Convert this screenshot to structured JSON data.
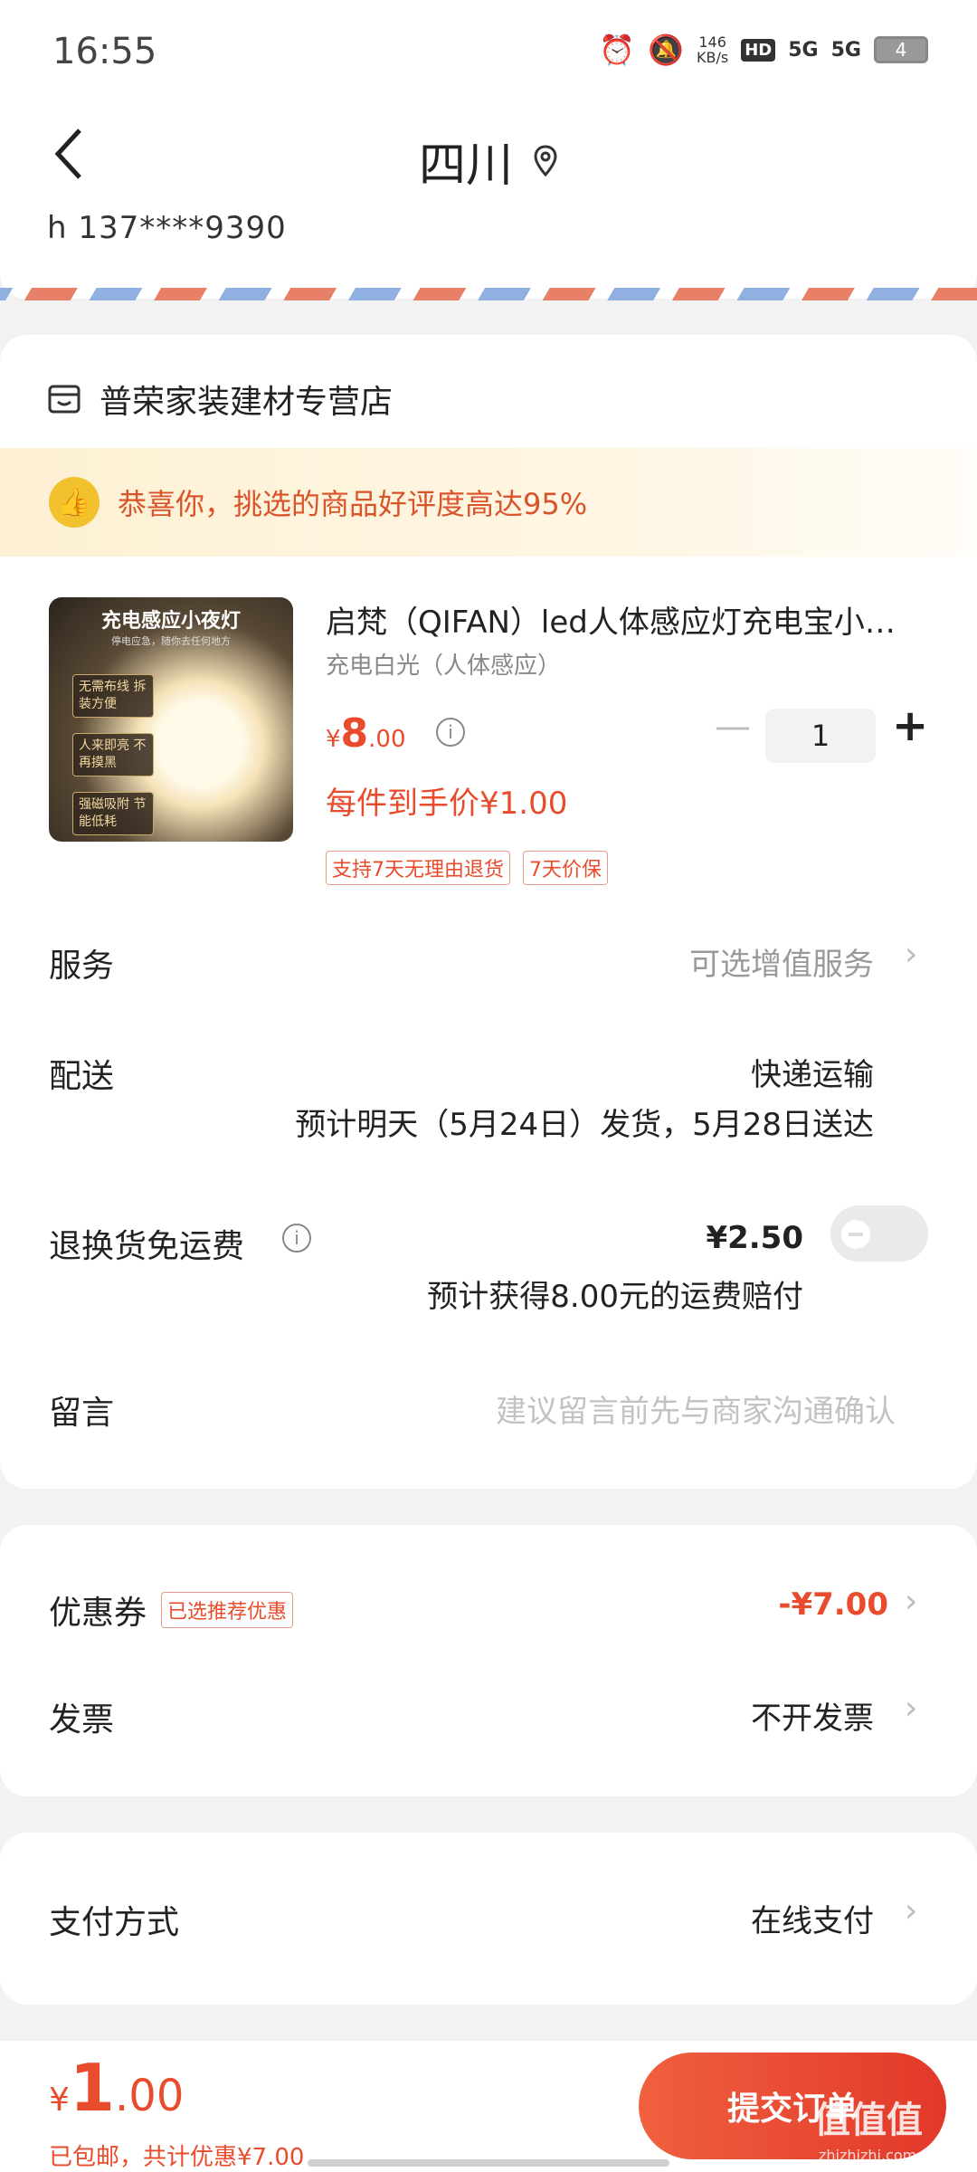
{
  "status_bar": {
    "time": "16:55",
    "net_speed_value": "146",
    "net_speed_unit": "KB/s",
    "hd": "HD",
    "signal1": "5G",
    "signal2": "5G",
    "battery": "4"
  },
  "header": {
    "title": "四川",
    "phone": "h  137****9390"
  },
  "store": {
    "name": "普荣家装建材专营店"
  },
  "banner": {
    "text": "恭喜你，挑选的商品好评度高达95%"
  },
  "product": {
    "image_title": "充电感应小夜灯",
    "image_subtitle": "停电应急，随你去任何地方",
    "image_tags": [
      "无需布线 拆装方便",
      "人来即亮 不再摸黑",
      "强磁吸附 节能低耗"
    ],
    "title": "启梵（QIFAN）led人体感应灯充电宝小夜灯",
    "spec": "充电白光（人体感应）",
    "price_symbol": "¥",
    "price_int": "8",
    "price_dec": ".00",
    "quantity": "1",
    "final_price": "每件到手价¥1.00",
    "badges": [
      "支持7天无理由退货",
      "7天价保"
    ]
  },
  "rows": {
    "service_label": "服务",
    "service_value": "可选增值服务",
    "delivery_label": "配送",
    "delivery_method": "快递运输",
    "delivery_eta": "预计明天（5月24日）发货，5月28日送达",
    "return_label": "退换货免运费",
    "return_price": "¥2.50",
    "return_note": "预计获得8.00元的运费赔付",
    "message_label": "留言",
    "message_placeholder": "建议留言前先与商家沟通确认"
  },
  "coupon": {
    "label": "优惠券",
    "badge": "已选推荐优惠",
    "value": "-¥7.00"
  },
  "invoice": {
    "label": "发票",
    "value": "不开发票"
  },
  "payment": {
    "label": "支付方式",
    "value": "在线支付"
  },
  "bottom": {
    "symbol": "¥",
    "total_int": "1",
    "total_dec": ".00",
    "note": "已包邮，共计优惠¥7.00",
    "submit": "提交订单",
    "watermark": "值值值",
    "watermark_sub": "zhizhizhi.com"
  },
  "colors": {
    "accent": "#e84c2c",
    "banner_bg": "#fdf0d3"
  }
}
